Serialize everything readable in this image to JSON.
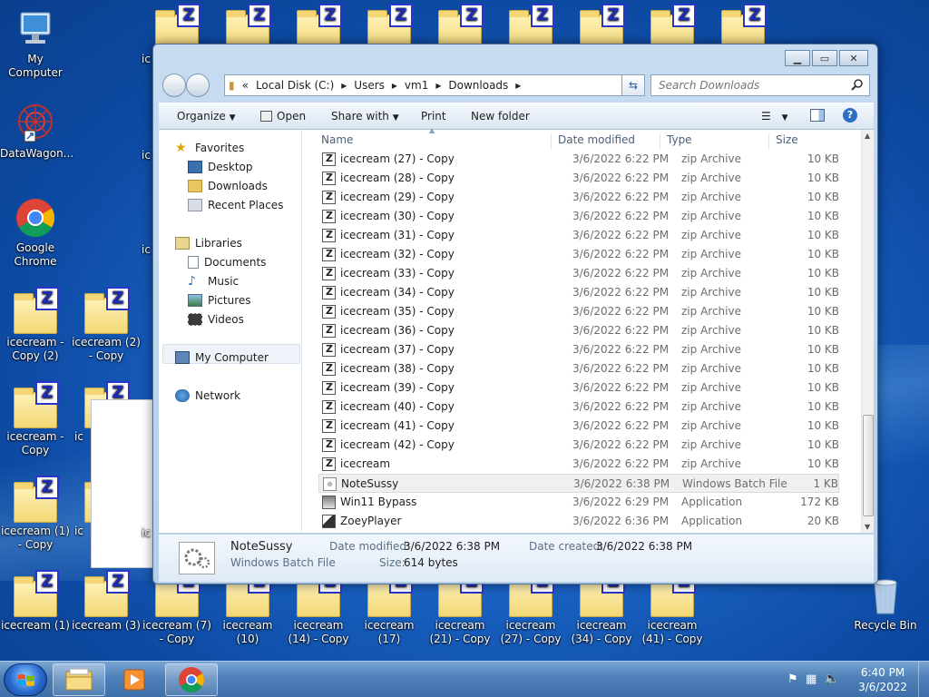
{
  "desktop": {
    "icons": [
      {
        "label": "My Computer"
      },
      {
        "label": "DataWagon..."
      },
      {
        "label": "Google Chrome"
      },
      {
        "label": "icecream - Copy (2)"
      },
      {
        "label": "icecream (2) - Copy"
      },
      {
        "label": "icecream - Copy"
      },
      {
        "label": "icecream (1) - Copy"
      },
      {
        "label": "icecream (1)"
      },
      {
        "label": "icecream (3)"
      },
      {
        "label": "icecream (7) - Copy"
      },
      {
        "label": "icecream (10)"
      },
      {
        "label": "icecream (14) - Copy"
      },
      {
        "label": "icecream (17)"
      },
      {
        "label": "icecream (21) - Copy"
      },
      {
        "label": "icecream (27) - Copy"
      },
      {
        "label": "icecream (34) - Copy"
      },
      {
        "label": "icecream (41) - Copy"
      },
      {
        "label": "Recycle Bin"
      }
    ],
    "peek_labels": [
      "ic",
      "ic",
      "ic",
      "ic",
      "ic",
      "ic"
    ]
  },
  "explorer": {
    "path": [
      "«",
      "Local Disk (C:)",
      "Users",
      "vm1",
      "Downloads"
    ],
    "search_placeholder": "Search Downloads",
    "toolbar": {
      "organize": "Organize",
      "open": "Open",
      "share_with": "Share with",
      "print": "Print",
      "new_folder": "New folder"
    },
    "nav": {
      "favorites": "Favorites",
      "desktop": "Desktop",
      "downloads": "Downloads",
      "recent": "Recent Places",
      "libraries": "Libraries",
      "documents": "Documents",
      "music": "Music",
      "pictures": "Pictures",
      "videos": "Videos",
      "computer": "My Computer",
      "network": "Network"
    },
    "columns": {
      "name": "Name",
      "date": "Date modified",
      "type": "Type",
      "size": "Size"
    },
    "files": [
      {
        "name": "icecream (27) - Copy",
        "date": "3/6/2022 6:22 PM",
        "type": "zip Archive",
        "size": "10 KB",
        "icon": "zip"
      },
      {
        "name": "icecream (28) - Copy",
        "date": "3/6/2022 6:22 PM",
        "type": "zip Archive",
        "size": "10 KB",
        "icon": "zip"
      },
      {
        "name": "icecream (29) - Copy",
        "date": "3/6/2022 6:22 PM",
        "type": "zip Archive",
        "size": "10 KB",
        "icon": "zip"
      },
      {
        "name": "icecream (30) - Copy",
        "date": "3/6/2022 6:22 PM",
        "type": "zip Archive",
        "size": "10 KB",
        "icon": "zip"
      },
      {
        "name": "icecream (31) - Copy",
        "date": "3/6/2022 6:22 PM",
        "type": "zip Archive",
        "size": "10 KB",
        "icon": "zip"
      },
      {
        "name": "icecream (32) - Copy",
        "date": "3/6/2022 6:22 PM",
        "type": "zip Archive",
        "size": "10 KB",
        "icon": "zip"
      },
      {
        "name": "icecream (33) - Copy",
        "date": "3/6/2022 6:22 PM",
        "type": "zip Archive",
        "size": "10 KB",
        "icon": "zip"
      },
      {
        "name": "icecream (34) - Copy",
        "date": "3/6/2022 6:22 PM",
        "type": "zip Archive",
        "size": "10 KB",
        "icon": "zip"
      },
      {
        "name": "icecream (35) - Copy",
        "date": "3/6/2022 6:22 PM",
        "type": "zip Archive",
        "size": "10 KB",
        "icon": "zip"
      },
      {
        "name": "icecream (36) - Copy",
        "date": "3/6/2022 6:22 PM",
        "type": "zip Archive",
        "size": "10 KB",
        "icon": "zip"
      },
      {
        "name": "icecream (37) - Copy",
        "date": "3/6/2022 6:22 PM",
        "type": "zip Archive",
        "size": "10 KB",
        "icon": "zip"
      },
      {
        "name": "icecream (38) - Copy",
        "date": "3/6/2022 6:22 PM",
        "type": "zip Archive",
        "size": "10 KB",
        "icon": "zip"
      },
      {
        "name": "icecream (39) - Copy",
        "date": "3/6/2022 6:22 PM",
        "type": "zip Archive",
        "size": "10 KB",
        "icon": "zip"
      },
      {
        "name": "icecream (40) - Copy",
        "date": "3/6/2022 6:22 PM",
        "type": "zip Archive",
        "size": "10 KB",
        "icon": "zip"
      },
      {
        "name": "icecream (41) - Copy",
        "date": "3/6/2022 6:22 PM",
        "type": "zip Archive",
        "size": "10 KB",
        "icon": "zip"
      },
      {
        "name": "icecream (42) - Copy",
        "date": "3/6/2022 6:22 PM",
        "type": "zip Archive",
        "size": "10 KB",
        "icon": "zip"
      },
      {
        "name": "icecream",
        "date": "3/6/2022 6:22 PM",
        "type": "zip Archive",
        "size": "10 KB",
        "icon": "zip"
      },
      {
        "name": "NoteSussy",
        "date": "3/6/2022 6:38 PM",
        "type": "Windows Batch File",
        "size": "1 KB",
        "icon": "bat",
        "selected": true
      },
      {
        "name": "Win11 Bypass",
        "date": "3/6/2022 6:29 PM",
        "type": "Application",
        "size": "172 KB",
        "icon": "app"
      },
      {
        "name": "ZoeyPlayer",
        "date": "3/6/2022 6:36 PM",
        "type": "Application",
        "size": "20 KB",
        "icon": "app2"
      }
    ],
    "details": {
      "name": "NoteSussy",
      "type": "Windows Batch File",
      "modified_label": "Date modified:",
      "modified": "3/6/2022 6:38 PM",
      "created_label": "Date created:",
      "created": "3/6/2022 6:38 PM",
      "size_label": "Size:",
      "size": "614 bytes"
    }
  },
  "taskbar": {
    "time": "6:40 PM",
    "date": "3/6/2022"
  }
}
